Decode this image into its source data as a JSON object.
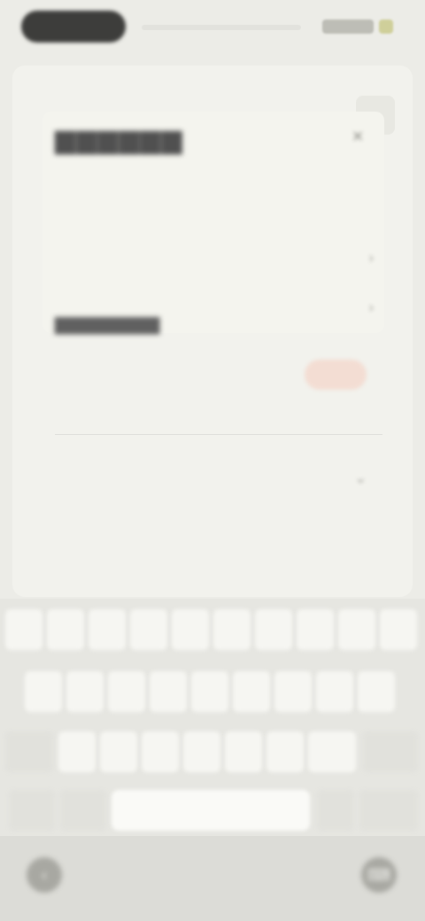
{
  "status_bar": {
    "time": "",
    "icons": [
      "signal-icon",
      "battery-icon"
    ]
  },
  "section": {
    "title": "",
    "rows": [
      {
        "label": ""
      },
      {
        "label": ""
      }
    ]
  },
  "subsection": {
    "title": "",
    "description": "",
    "action_label": ""
  },
  "bottom_row": {
    "label": ""
  },
  "keyboard": {
    "row1": [
      "",
      "",
      "",
      "",
      "",
      "",
      "",
      "",
      "",
      ""
    ],
    "row2": [
      "",
      "",
      "",
      "",
      "",
      "",
      "",
      "",
      ""
    ],
    "row3": [
      "",
      "",
      "",
      "",
      "",
      "",
      "",
      "",
      "",
      ""
    ],
    "space_label": ""
  },
  "colors": {
    "accent": "#d47f63",
    "background": "#ecece7",
    "keyboard": "#e6e6e1"
  }
}
